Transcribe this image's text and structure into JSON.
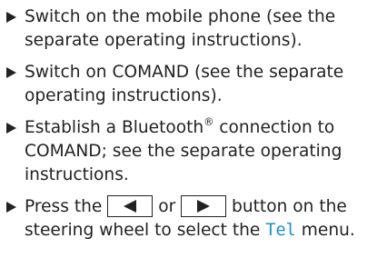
{
  "steps": [
    {
      "text": "Switch on the mobile phone (see the separate operating instructions)."
    },
    {
      "text": "Switch on COMAND (see the separate operating instructions)."
    },
    {
      "text_before_mark": "Establish a Bluetooth",
      "registered_mark": "®",
      "text_after_mark": " connection to COMAND; see the separate operating instructions."
    },
    {
      "text_1": "Press the ",
      "button_left_icon": "left-arrow-icon",
      "text_2": " or ",
      "button_right_icon": "right-arrow-icon",
      "text_3": " button on the steering wheel to select the ",
      "menu_name": "Tel",
      "text_4": " menu."
    }
  ],
  "colors": {
    "text": "#222222",
    "menu_accent": "#1f8fc7"
  }
}
